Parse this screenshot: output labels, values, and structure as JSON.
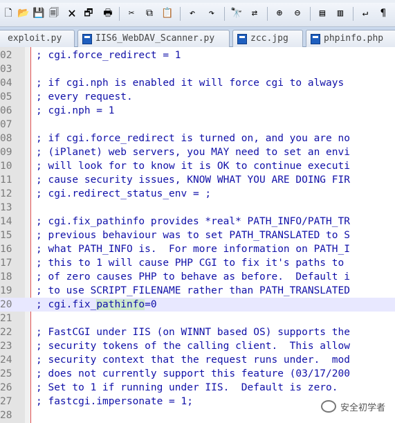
{
  "toolbar": {
    "icons": [
      "new-file-icon",
      "open-icon",
      "save-icon",
      "save-all-icon",
      "close-icon",
      "close-all-icon",
      "print-icon",
      "cut-icon",
      "copy-icon",
      "paste-icon",
      "undo-icon",
      "redo-icon",
      "find-icon",
      "replace-icon",
      "zoom-in-icon",
      "zoom-out-icon",
      "sync-vertical-icon",
      "sync-horizontal-icon",
      "word-wrap-icon",
      "show-symbols-icon"
    ]
  },
  "tabs": [
    {
      "label": "exploit.py"
    },
    {
      "label": "IIS6_WebDAV_Scanner.py"
    },
    {
      "label": "zcc.jpg"
    },
    {
      "label": "phpinfo.php"
    }
  ],
  "editor": {
    "lines": [
      {
        "num": "02",
        "text": "; cgi.force_redirect = 1"
      },
      {
        "num": "03",
        "text": ""
      },
      {
        "num": "04",
        "text": "; if cgi.nph is enabled it will force cgi to always"
      },
      {
        "num": "05",
        "text": "; every request."
      },
      {
        "num": "06",
        "text": "; cgi.nph = 1"
      },
      {
        "num": "07",
        "text": ""
      },
      {
        "num": "08",
        "text": "; if cgi.force_redirect is turned on, and you are no"
      },
      {
        "num": "09",
        "text": "; (iPlanet) web servers, you MAY need to set an envi"
      },
      {
        "num": "10",
        "text": "; will look for to know it is OK to continue executi"
      },
      {
        "num": "11",
        "text": "; cause security issues, KNOW WHAT YOU ARE DOING FIR"
      },
      {
        "num": "12",
        "text": "; cgi.redirect_status_env = ;"
      },
      {
        "num": "13",
        "text": ""
      },
      {
        "num": "14",
        "text": "; cgi.fix_pathinfo provides *real* PATH_INFO/PATH_TR"
      },
      {
        "num": "15",
        "text": "; previous behaviour was to set PATH_TRANSLATED to S"
      },
      {
        "num": "16",
        "text": "; what PATH_INFO is.  For more information on PATH_I"
      },
      {
        "num": "17",
        "text": "; this to 1 will cause PHP CGI to fix it's paths to"
      },
      {
        "num": "18",
        "text": "; of zero causes PHP to behave as before.  Default i"
      },
      {
        "num": "19",
        "text": "; to use SCRIPT_FILENAME rather than PATH_TRANSLATED"
      },
      {
        "num": "20",
        "pre": "; cgi.fix_",
        "mark": "pathinfo",
        "post": "=0"
      },
      {
        "num": "21",
        "text": ""
      },
      {
        "num": "22",
        "text": "; FastCGI under IIS (on WINNT based OS) supports the"
      },
      {
        "num": "23",
        "text": "; security tokens of the calling client.  This allow"
      },
      {
        "num": "24",
        "text": "; security context that the request runs under.  mod"
      },
      {
        "num": "25",
        "text": "; does not currently support this feature (03/17/200"
      },
      {
        "num": "26",
        "text": "; Set to 1 if running under IIS.  Default is zero."
      },
      {
        "num": "27",
        "text": "; fastcgi.impersonate = 1;"
      },
      {
        "num": "28",
        "text": ""
      }
    ]
  },
  "watermark": {
    "text": "安全初学者"
  }
}
